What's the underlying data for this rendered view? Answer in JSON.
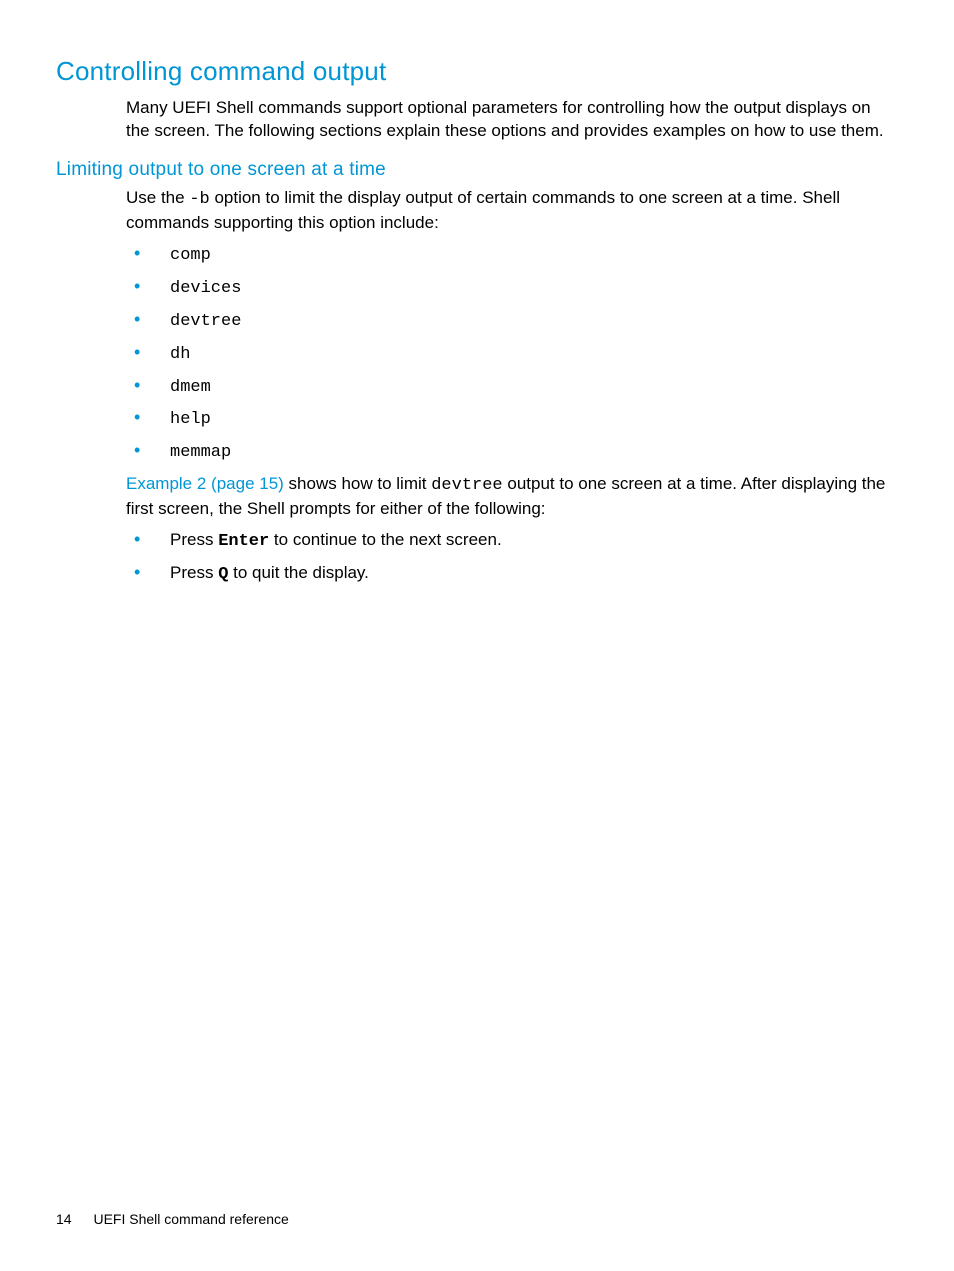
{
  "heading1": "Controlling command output",
  "intro": "Many UEFI Shell commands support optional parameters for controlling how the output displays on the screen. The following sections explain these options and provides examples on how to use them.",
  "heading2": "Limiting output to one screen at a time",
  "para2_pre": "Use the  ",
  "para2_opt": "-b",
  "para2_post": " option to limit the display output of certain commands to one screen at a time. Shell commands supporting this option include:",
  "cmd_list": {
    "0": "comp",
    "1": "devices",
    "2": "devtree",
    "3": "dh",
    "4": "dmem",
    "5": "help",
    "6": "memmap"
  },
  "example_link": "Example 2 (page 15)",
  "example_mid1": " shows how to limit ",
  "example_cmd": "devtree",
  "example_mid2": " output to one screen at a time. After displaying the first screen, the Shell prompts for either of the following:",
  "action1_pre": "Press ",
  "action1_key": "Enter",
  "action1_post": " to continue to the next screen.",
  "action2_pre": "Press ",
  "action2_key": "Q",
  "action2_post": " to quit the display.",
  "footer_page": "14",
  "footer_title": "UEFI Shell command reference"
}
